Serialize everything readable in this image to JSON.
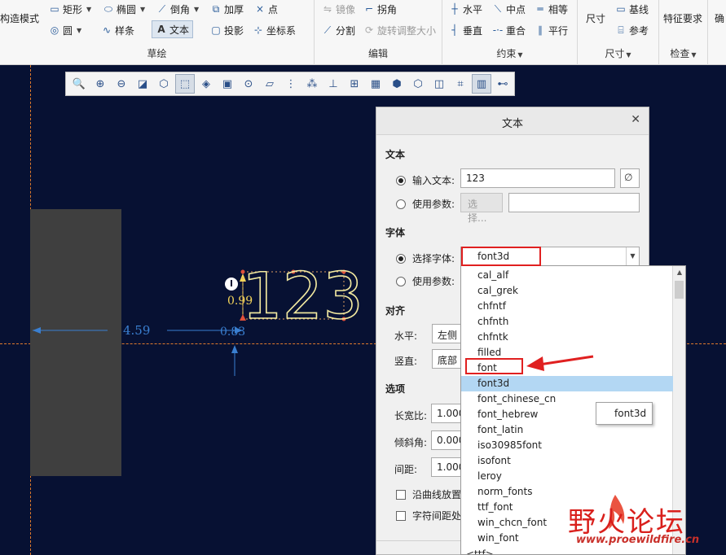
{
  "colors": {
    "canvas": "#071133",
    "guide": "#e07a2c",
    "selection": "#b3d7f3",
    "annotation_red": "#e02020",
    "dim_blue": "#3a7fd0",
    "text_outline": "#f2e9a0"
  },
  "ribbon": {
    "groups": [
      {
        "label": "草绘",
        "items": [
          {
            "label": "构造模式",
            "icon": "construction-icon"
          },
          {
            "label": "矩形",
            "icon": "rectangle-icon",
            "dropdown": true
          },
          {
            "label": "椭圆",
            "icon": "ellipse-icon",
            "dropdown": true
          },
          {
            "label": "倒角",
            "icon": "chamfer-icon",
            "dropdown": true
          },
          {
            "label": "加厚",
            "icon": "thicken-icon"
          },
          {
            "label": "点",
            "icon": "point-icon"
          },
          {
            "label": "圆",
            "icon": "circle-icon",
            "dropdown": true
          },
          {
            "label": "样条",
            "icon": "spline-icon"
          },
          {
            "label": "文本",
            "icon": "text-icon",
            "active": true
          },
          {
            "label": "投影",
            "icon": "project-icon"
          },
          {
            "label": "坐标系",
            "icon": "coordinate-system-icon"
          }
        ]
      },
      {
        "label": "编辑",
        "items": [
          {
            "label": "镜像",
            "icon": "mirror-icon",
            "disabled": true
          },
          {
            "label": "拐角",
            "icon": "corner-icon"
          },
          {
            "label": "分割",
            "icon": "divide-icon"
          },
          {
            "label": "旋转调整大小",
            "icon": "rotate-resize-icon",
            "disabled": true
          }
        ]
      },
      {
        "label": "约束",
        "items": [
          {
            "label": "水平",
            "icon": "horizontal-icon"
          },
          {
            "label": "中点",
            "icon": "midpoint-icon"
          },
          {
            "label": "相等",
            "icon": "equal-icon"
          },
          {
            "label": "垂直",
            "icon": "vertical-icon"
          },
          {
            "label": "重合",
            "icon": "coincident-icon"
          },
          {
            "label": "平行",
            "icon": "parallel-icon"
          }
        ]
      },
      {
        "label": "尺寸",
        "items": [
          {
            "label": "尺寸",
            "icon": "dimension-icon"
          },
          {
            "label": "基线",
            "icon": "baseline-icon"
          },
          {
            "label": "参考",
            "icon": "reference-icon"
          }
        ]
      },
      {
        "label": "检查",
        "items": [
          {
            "label": "特征要求",
            "icon": "feature-requirements-icon"
          }
        ]
      }
    ],
    "overflow_label": "确"
  },
  "graphics_toolbar": {
    "icons": [
      "refit-icon",
      "zoom-in-icon",
      "zoom-out-icon",
      "repaint-icon",
      "display-style-icon",
      "saved-orientations-icon",
      "view-manager-icon",
      "perspective-icon",
      "spin-center-icon",
      "plane-display-icon",
      "axis-display-icon",
      "point-display-icon",
      "csys-display-icon",
      "annotation-display-icon",
      "sketch-view-icon",
      "dimension-display-icon",
      "constraint-display-icon",
      "grid-display-icon",
      "vertex-display-icon",
      "sketch-display-icon",
      "disjoint-display-icon"
    ]
  },
  "canvas": {
    "sketch_text": "123",
    "dims": {
      "horizontal": "4.59",
      "small": "0.83",
      "height": "0.99"
    }
  },
  "dialog": {
    "title": "文本",
    "close_icon": "close-icon",
    "section_text": "文本",
    "input_text_label": "输入文本:",
    "input_text_value": "123",
    "symbol_button_icon": "text-symbol-icon",
    "use_param_label": "使用参数:",
    "select_button": "选择...",
    "section_font": "字体",
    "select_font_label": "选择字体:",
    "font_value": "font3d",
    "use_param2_label": "使用参数:",
    "section_align": "对齐",
    "horizontal_label": "水平:",
    "horizontal_value": "左侧",
    "vertical_label": "竖直:",
    "vertical_value": "底部",
    "section_options": "选项",
    "aspect_label": "长宽比:",
    "aspect_value": "1.000",
    "slant_label": "倾斜角:",
    "slant_value": "0.000",
    "spacing_label": "间距:",
    "spacing_value": "1.000",
    "along_curve_label": "沿曲线放置",
    "char_spacing_label": "字符间距处"
  },
  "font_list": {
    "items": [
      "cal_alf",
      "cal_grek",
      "chfntf",
      "chfnth",
      "chfntk",
      "filled",
      "font",
      "font3d",
      "font_chinese_cn",
      "font_hebrew",
      "font_latin",
      "iso30985font",
      "isofont",
      "leroy",
      "norm_fonts",
      "ttf_font",
      "win_chcn_font",
      "win_font"
    ],
    "selected": "font3d",
    "footer_partial": "<ttf>",
    "tooltip": "font3d"
  },
  "watermark": {
    "title": "野火论坛",
    "url": "www.proewildfire.cn"
  }
}
